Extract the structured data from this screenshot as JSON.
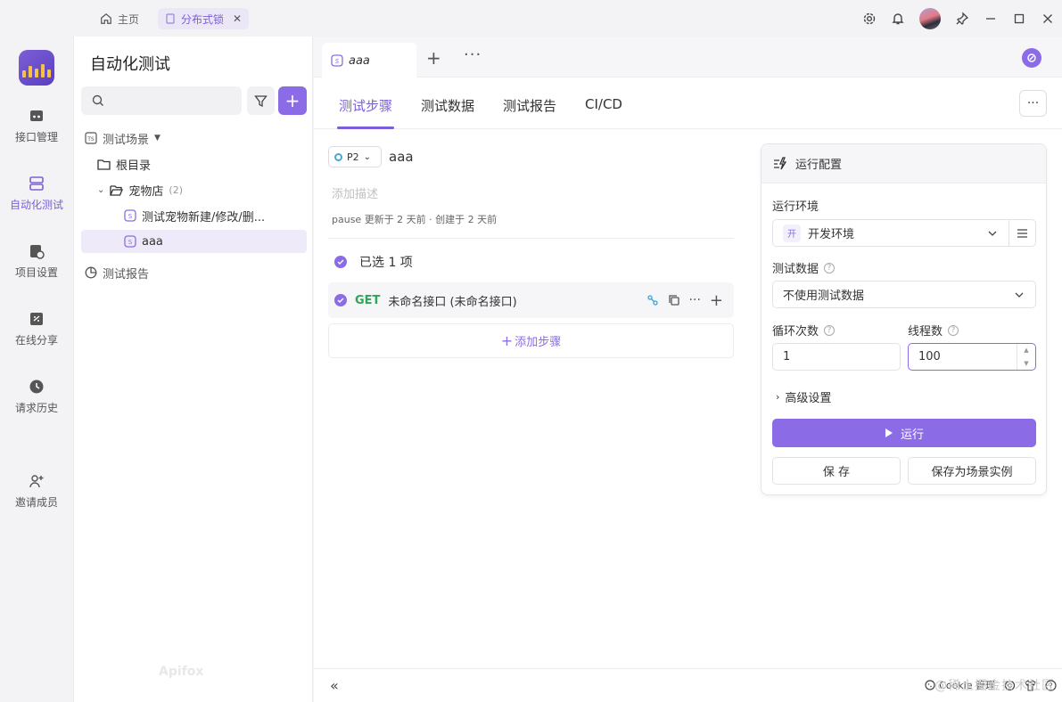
{
  "titlebar": {
    "home_label": "主页",
    "tab_label": "分布式锁",
    "tab_close": "✕"
  },
  "rail": {
    "items": [
      {
        "label": "接口管理"
      },
      {
        "label": "自动化测试"
      },
      {
        "label": "项目设置"
      },
      {
        "label": "在线分享"
      },
      {
        "label": "请求历史"
      },
      {
        "label": "邀请成员"
      }
    ]
  },
  "sidebar": {
    "title": "自动化测试",
    "search_placeholder": "",
    "add_label": "+",
    "tree": {
      "scenario_group": "测试场景",
      "root": "根目录",
      "folder": "宠物店",
      "folder_count": "(2)",
      "case1": "测试宠物新建/修改/删...",
      "case2": "aaa",
      "report": "测试报告"
    },
    "watermark": "Apifox"
  },
  "main": {
    "file_tab": "aaa",
    "tab_add": "+",
    "tab_more": "···",
    "subtabs": [
      "测试步骤",
      "测试数据",
      "测试报告",
      "CI/CD"
    ],
    "more_btn": "···",
    "priority": "P2",
    "case_name": "aaa",
    "desc_placeholder": "添加描述",
    "meta": "pause 更新于 2 天前 · 创建于 2 天前",
    "selected_text": "已选 1 项",
    "step": {
      "method": "GET",
      "name": "未命名接口 (未命名接口)"
    },
    "add_step": "添加步骤"
  },
  "run_panel": {
    "title": "运行配置",
    "env_label": "运行环境",
    "env_badge": "开",
    "env_value": "开发环境",
    "data_label": "测试数据",
    "data_value": "不使用测试数据",
    "loop_label": "循环次数",
    "loop_value": "1",
    "thread_label": "线程数",
    "thread_value": "100",
    "advanced": "高级设置",
    "run_button": "运行",
    "save_button": "保 存",
    "save_as_button": "保存为场景实例"
  },
  "footer": {
    "collapse": "«",
    "cookie": "Cookie 管理",
    "watermark": "@稀土掘金技术社区"
  },
  "colors": {
    "accent": "#8b6ce6",
    "get": "#2fa45a"
  }
}
